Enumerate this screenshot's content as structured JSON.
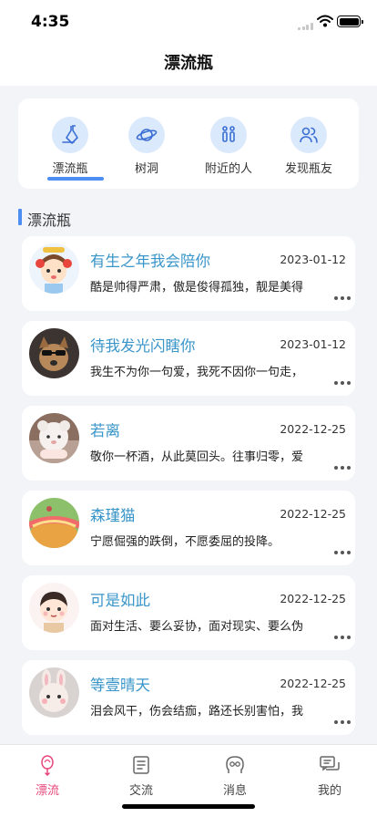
{
  "status": {
    "time": "4:35"
  },
  "nav": {
    "title": "漂流瓶"
  },
  "tabs": [
    {
      "label": "漂流瓶",
      "icon": "bottle-icon",
      "active": true
    },
    {
      "label": "树洞",
      "icon": "planet-icon",
      "active": false
    },
    {
      "label": "附近的人",
      "icon": "people-pair-icon",
      "active": false
    },
    {
      "label": "发现瓶友",
      "icon": "friends-icon",
      "active": false
    }
  ],
  "section": {
    "title": "漂流瓶"
  },
  "bottles": [
    {
      "name": "有生之年我会陪你",
      "date": "2023-01-12",
      "text": "酷是帅得严肃，傲是俊得孤独，靓是美得",
      "avatar": "cartoon-girl-avatar"
    },
    {
      "name": "待我发光闪瞎你",
      "date": "2023-01-12",
      "text": "我生不为你一句爱，我死不因你一句走，",
      "avatar": "dog-avatar"
    },
    {
      "name": "若离",
      "date": "2022-12-25",
      "text": "敬你一杯酒，从此莫回头。往事归零，爱",
      "avatar": "plush-avatar"
    },
    {
      "name": "森瑾猫",
      "date": "2022-12-25",
      "text": "宁愿倔强的跌倒，不愿委屈的投降。",
      "avatar": "cake-avatar"
    },
    {
      "name": "可是如此",
      "date": "2022-12-25",
      "text": "面对生活、要么妥协，面对现实、要么伪",
      "avatar": "cartoon-boy-avatar"
    },
    {
      "name": "等壹晴天",
      "date": "2022-12-25",
      "text": "泪会风干，伤会结痂，路还长别害怕，我",
      "avatar": "bunny-avatar"
    }
  ],
  "tabbar": [
    {
      "label": "漂流",
      "icon": "bottle-icon",
      "active": true
    },
    {
      "label": "交流",
      "icon": "document-icon",
      "active": false
    },
    {
      "label": "消息",
      "icon": "head-icon",
      "active": false
    },
    {
      "label": "我的",
      "icon": "chat-icon",
      "active": false
    }
  ],
  "colors": {
    "accent": "#4d8ef2",
    "active_tab": "#e8457a",
    "name": "#3a95c9"
  }
}
